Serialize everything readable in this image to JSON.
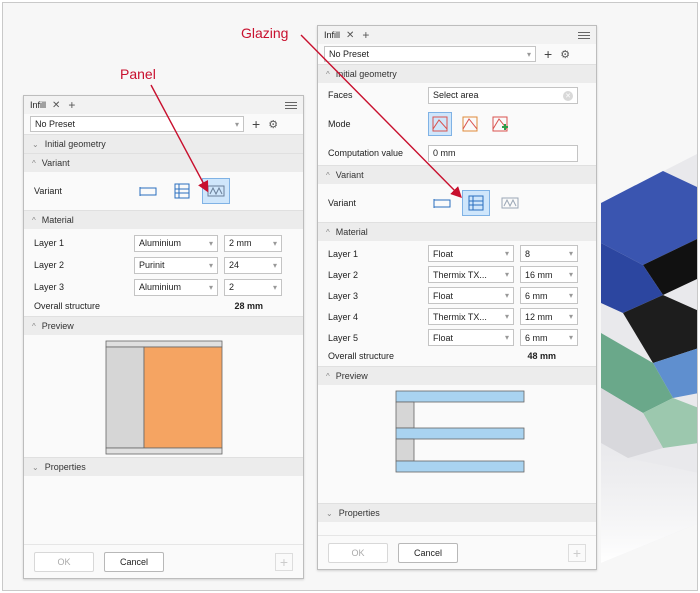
{
  "callouts": {
    "panel": "Panel",
    "glazing": "Glazing"
  },
  "left_panel": {
    "tab_label": "Infill",
    "preset": "No Preset",
    "sections": {
      "initial_geometry": "Initial geometry",
      "variant": "Variant",
      "material": "Material",
      "preview": "Preview",
      "properties": "Properties"
    },
    "variant_label": "Variant",
    "selected_variant": 3,
    "layers": [
      {
        "label": "Layer 1",
        "material": "Aluminium",
        "thickness": "2 mm"
      },
      {
        "label": "Layer 2",
        "material": "Purinit",
        "thickness": "24"
      },
      {
        "label": "Layer 3",
        "material": "Aluminium",
        "thickness": "2"
      }
    ],
    "overall_label": "Overall structure",
    "overall_value": "28 mm",
    "ok_label": "OK",
    "cancel_label": "Cancel"
  },
  "right_panel": {
    "tab_label": "Infill",
    "preset": "No Preset",
    "sections": {
      "initial_geometry": "Initial geometry",
      "variant": "Variant",
      "material": "Material",
      "preview": "Preview",
      "properties": "Properties"
    },
    "faces_label": "Faces",
    "faces_value": "Select area",
    "mode_label": "Mode",
    "computation_label": "Computation value",
    "computation_value": "0 mm",
    "variant_label": "Variant",
    "selected_variant": 2,
    "layers": [
      {
        "label": "Layer 1",
        "material": "Float",
        "thickness": "8"
      },
      {
        "label": "Layer 2",
        "material": "Thermix TX...",
        "thickness": "16 mm"
      },
      {
        "label": "Layer 3",
        "material": "Float",
        "thickness": "6 mm"
      },
      {
        "label": "Layer 4",
        "material": "Thermix TX...",
        "thickness": "12 mm"
      },
      {
        "label": "Layer 5",
        "material": "Float",
        "thickness": "6 mm"
      }
    ],
    "overall_label": "Overall structure",
    "overall_value": "48 mm",
    "ok_label": "OK",
    "cancel_label": "Cancel"
  },
  "colors": {
    "accent": "#c8102e",
    "selected_bg": "#cfe6fb",
    "panel_fill": "#f5a462",
    "glass_fill": "#a9d3f0",
    "blue_3d": "#2f4fa8",
    "green_3d": "#6aa88a"
  },
  "icons": {
    "close": "close-icon",
    "add": "plus-icon",
    "menu": "hamburger-menu-icon",
    "settings": "gear-icon"
  }
}
